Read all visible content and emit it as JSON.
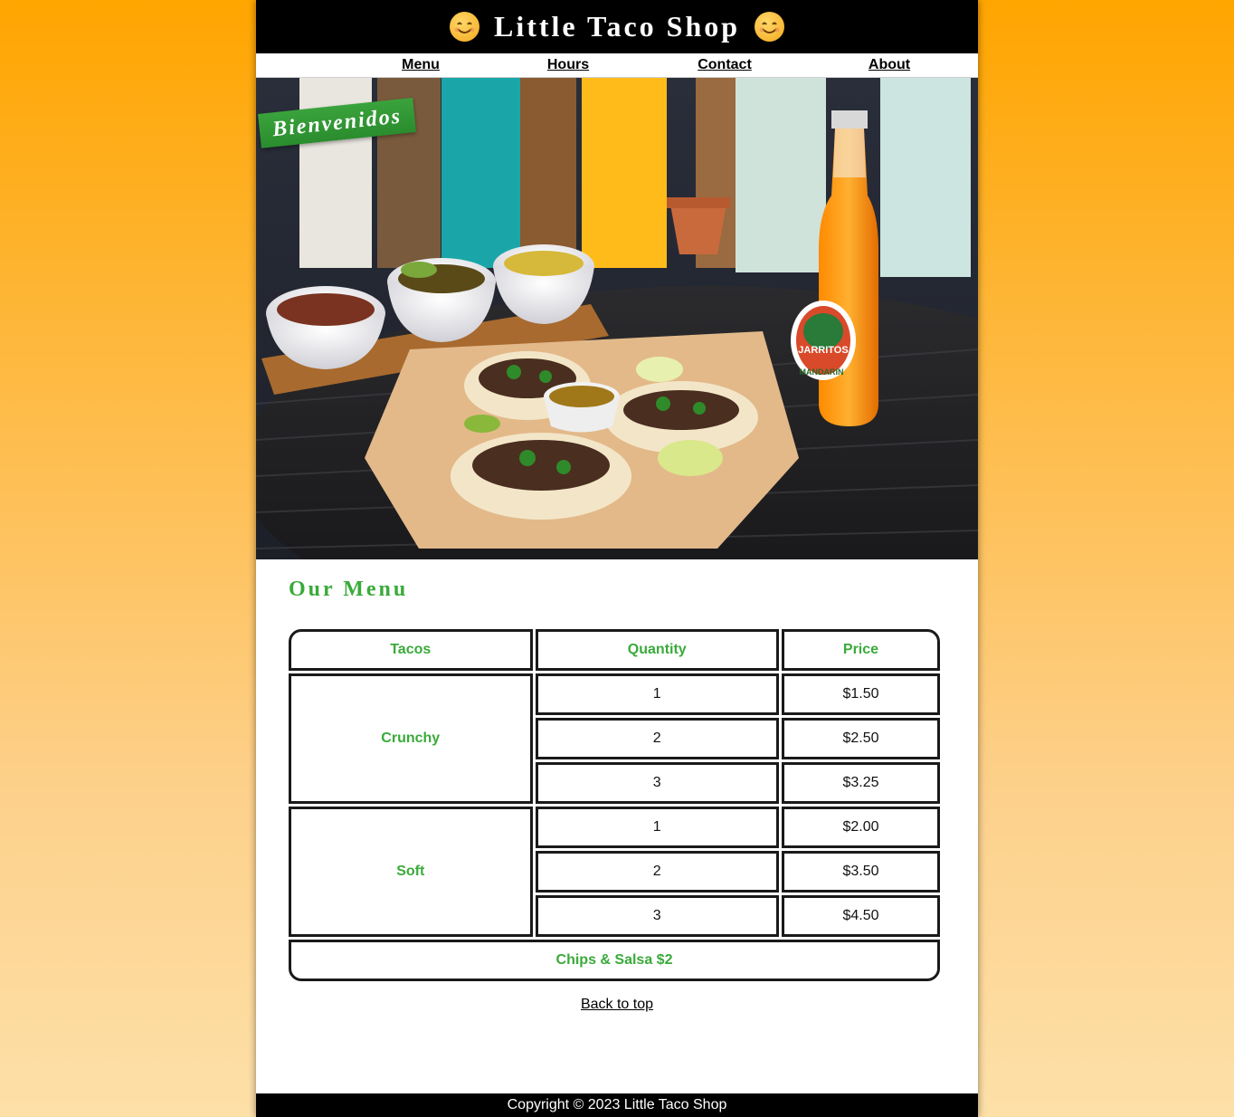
{
  "header": {
    "title": "Little Taco Shop",
    "emoji_icon": "smiling-face-emoji"
  },
  "nav": {
    "items": [
      {
        "label": "Menu"
      },
      {
        "label": "Hours"
      },
      {
        "label": "Contact"
      },
      {
        "label": "About"
      }
    ]
  },
  "hero": {
    "banner": "Bienvenidos",
    "bottle_label": "JARRITOS",
    "bottle_flavor": "MANDARIN"
  },
  "menu": {
    "title": "Our Menu",
    "headers": [
      "Tacos",
      "Quantity",
      "Price"
    ],
    "groups": [
      {
        "name": "Crunchy",
        "rows": [
          {
            "quantity": "1",
            "price": "$1.50"
          },
          {
            "quantity": "2",
            "price": "$2.50"
          },
          {
            "quantity": "3",
            "price": "$3.25"
          }
        ]
      },
      {
        "name": "Soft",
        "rows": [
          {
            "quantity": "1",
            "price": "$2.00"
          },
          {
            "quantity": "2",
            "price": "$3.50"
          },
          {
            "quantity": "3",
            "price": "$4.50"
          }
        ]
      }
    ],
    "footer_row": "Chips & Salsa $2"
  },
  "back_to_top": "Back to top",
  "footer": {
    "copyright": "Copyright © 2023 Little Taco Shop"
  },
  "colors": {
    "accent_green": "#3aaa3a",
    "background_orange": "#ffa500",
    "header_black": "#000000"
  }
}
